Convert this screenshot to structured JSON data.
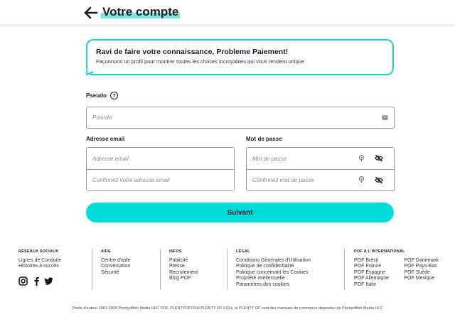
{
  "header": {
    "title": "Votre compte",
    "back_icon": "arrow-left-icon"
  },
  "welcome": {
    "title": "Ravi de faire votre connaissance, Probleme Paiement!",
    "subtitle": "Façonnons un profil pour montrer toutes les choses incroyables qui vous rendent unique"
  },
  "form": {
    "pseudo_label": "Pseudo",
    "help_symbol": "?",
    "pseudo_placeholder": "Pseudo",
    "email_label": "Adresse email",
    "email_placeholder": "Adresse email",
    "email_confirm_placeholder": "Confirmez votre adresse email",
    "password_label": "Mot de passe",
    "password_placeholder": "Mot de passe",
    "password_confirm_placeholder": "Confirmez mot de passe",
    "submit_label": "Suivant"
  },
  "footer": {
    "social": {
      "title": "RÉSEAUX SOCIAUX",
      "links": [
        "Lignes de Conduite",
        "Histoires à succès"
      ],
      "icons": [
        "instagram-icon",
        "facebook-icon",
        "twitter-icon"
      ]
    },
    "help": {
      "title": "AIDE",
      "links": [
        "Centre d'aide",
        "Conversation",
        "Sécurité"
      ]
    },
    "info": {
      "title": "INFOS",
      "links": [
        "Publicité",
        "Presse",
        "Recrutement",
        "Blog POF"
      ]
    },
    "legal": {
      "title": "LÉGAL",
      "links": [
        "Conditions Générales d'Utilisation",
        "Politique de confidentialité",
        "Politique concernant les Cookies",
        "Propriété intellectuelle",
        "Paramètres des cookies"
      ]
    },
    "international": {
      "title": "POF À L'INTERNATIONAL",
      "col1": [
        "POF Brésil",
        "POF France",
        "POF Espagne",
        "POF Allemagne",
        "POF Italie"
      ],
      "col2": [
        "POF Danemark",
        "POF Pays-Bas",
        "POF Suède",
        "POF Mexique"
      ]
    },
    "copyright": "Droits d'auteur 2001-2020 Plentyoffish Media ULC POF, PLENTYOFFISH PLENTY OF FISH, et PLENTY OF sont des marques de commerce déposées de Plentyoffish Media ULC"
  },
  "colors": {
    "accent": "#00dcd9",
    "bubble_border": "#1bd2d2",
    "title_highlight": "#7ae6e2",
    "text_dark": "#1b1b2b"
  }
}
